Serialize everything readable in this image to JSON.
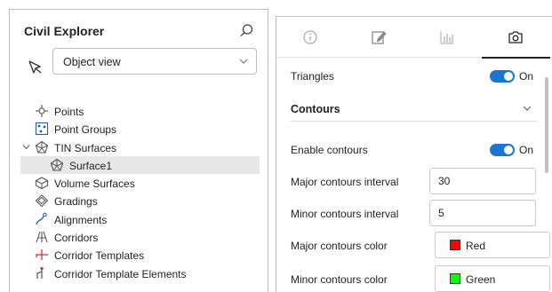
{
  "explorer": {
    "title": "Civil Explorer",
    "view_select": {
      "value": "Object view"
    },
    "tree": [
      {
        "label": "Points",
        "icon": "points-icon",
        "indent": 0,
        "twisty": "",
        "selected": false
      },
      {
        "label": "Point Groups",
        "icon": "point-groups-icon",
        "indent": 0,
        "twisty": "",
        "selected": false
      },
      {
        "label": "TIN Surfaces",
        "icon": "tin-surfaces-icon",
        "indent": 0,
        "twisty": "expanded",
        "selected": false
      },
      {
        "label": "Surface1",
        "icon": "surface-icon",
        "indent": 1,
        "twisty": "",
        "selected": true
      },
      {
        "label": "Volume Surfaces",
        "icon": "volume-surfaces-icon",
        "indent": 0,
        "twisty": "",
        "selected": false
      },
      {
        "label": "Gradings",
        "icon": "gradings-icon",
        "indent": 0,
        "twisty": "",
        "selected": false
      },
      {
        "label": "Alignments",
        "icon": "alignments-icon",
        "indent": 0,
        "twisty": "",
        "selected": false
      },
      {
        "label": "Corridors",
        "icon": "corridors-icon",
        "indent": 0,
        "twisty": "",
        "selected": false
      },
      {
        "label": "Corridor Templates",
        "icon": "corridor-templates-icon",
        "indent": 0,
        "twisty": "",
        "selected": false
      },
      {
        "label": "Corridor Template Elements",
        "icon": "corridor-template-elements-icon",
        "indent": 0,
        "twisty": "",
        "selected": false
      }
    ]
  },
  "properties": {
    "tabs": [
      {
        "icon": "info-icon",
        "active": false
      },
      {
        "icon": "edit-icon",
        "active": false
      },
      {
        "icon": "bar-chart-icon",
        "active": false
      },
      {
        "icon": "camera-icon",
        "active": true
      }
    ],
    "triangles": {
      "label": "Triangles",
      "toggle_text": "On"
    },
    "contours_section": {
      "title": "Contours"
    },
    "enable_contours": {
      "label": "Enable contours",
      "toggle_text": "On"
    },
    "major_interval": {
      "label": "Major contours interval",
      "value": "30"
    },
    "minor_interval": {
      "label": "Minor contours interval",
      "value": "5"
    },
    "major_color": {
      "label": "Major contours color",
      "color_name": "Red",
      "swatch": "#ff0000"
    },
    "minor_color": {
      "label": "Minor contours color",
      "color_name": "Green",
      "swatch": "#00ff00"
    }
  },
  "colors": {
    "accent": "#1976d2",
    "selected_row": "#e7e7e7",
    "border": "#bdbdbd"
  }
}
